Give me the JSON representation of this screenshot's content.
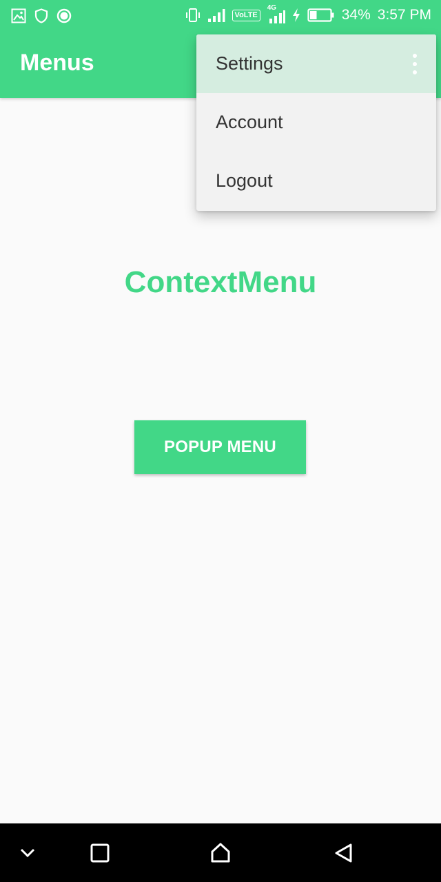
{
  "status_bar": {
    "left_icons": [
      "image-icon",
      "shield-icon",
      "circle-app-icon"
    ],
    "right_icons": [
      "vibrate-icon",
      "signal-icon",
      "volte-icon",
      "4g-signal-icon",
      "charging-icon",
      "battery-icon"
    ],
    "volte_label": "VoLTE",
    "network_label": "4G",
    "battery_percent": "34%",
    "time": "3:57 PM"
  },
  "app_bar": {
    "title": "Menus"
  },
  "overflow_menu": {
    "items": [
      {
        "label": "Settings"
      },
      {
        "label": "Account"
      },
      {
        "label": "Logout"
      }
    ]
  },
  "main": {
    "context_label": "ContextMenu",
    "popup_button_label": "POPUP MENU"
  },
  "nav_bar": {
    "buttons": [
      "chevron-down-icon",
      "recents-icon",
      "home-icon",
      "back-icon"
    ]
  },
  "colors": {
    "accent": "#42D787",
    "background": "#FAFAFA",
    "menu_background": "#F2F2F2",
    "menu_highlight": "#D5EDE0",
    "navbar": "#000000"
  }
}
